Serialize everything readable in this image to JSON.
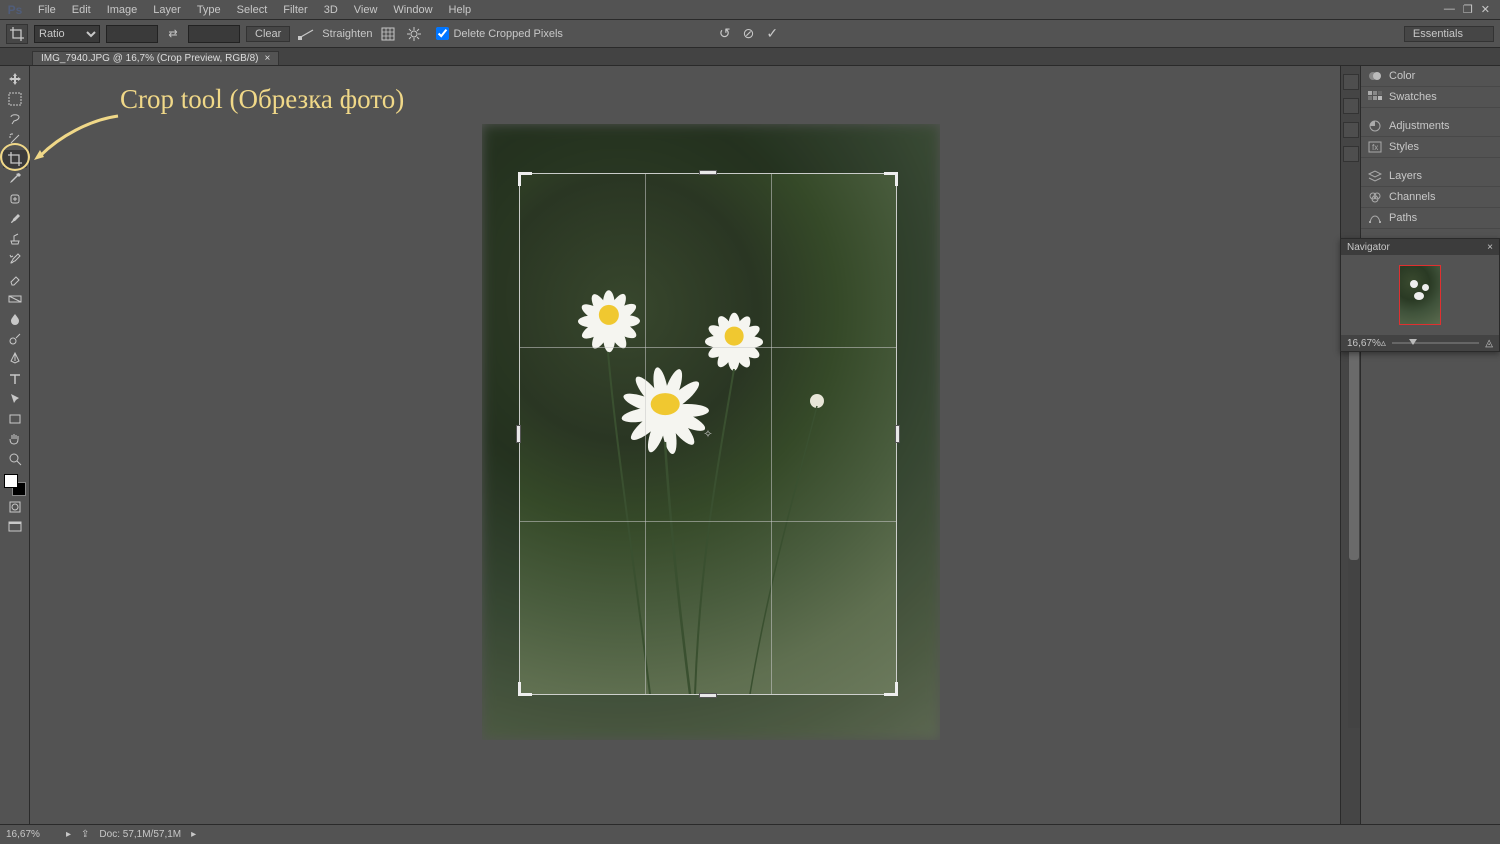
{
  "menu": {
    "items": [
      "File",
      "Edit",
      "Image",
      "Layer",
      "Type",
      "Select",
      "Filter",
      "3D",
      "View",
      "Window",
      "Help"
    ],
    "logo": "Ps"
  },
  "options": {
    "ratio_label": "Ratio",
    "clear": "Clear",
    "straighten": "Straighten",
    "delete_cropped": "Delete Cropped Pixels",
    "workspace": "Essentials"
  },
  "tab": {
    "title": "IMG_7940.JPG @ 16,7% (Crop Preview, RGB/8)",
    "close": "×"
  },
  "annotation": {
    "text": "Crop tool (Обрезка фото)"
  },
  "panels": {
    "color": "Color",
    "swatches": "Swatches",
    "adjustments": "Adjustments",
    "styles": "Styles",
    "layers": "Layers",
    "channels": "Channels",
    "paths": "Paths"
  },
  "navigator": {
    "title": "Navigator",
    "zoom": "16,67%"
  },
  "status": {
    "zoom": "16,67%",
    "doc": "Doc: 57,1M/57,1M"
  }
}
